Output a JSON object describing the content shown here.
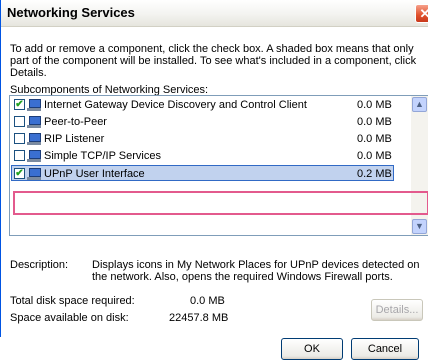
{
  "window": {
    "title": "Networking Services",
    "close_glyph": "✕"
  },
  "intro_text": "To add or remove a component, click the check box. A shaded box means that only part of the component will be installed. To see what's included in a component, click Details.",
  "subcomponents_label": "Subcomponents of Networking Services:",
  "components": [
    {
      "name": "Internet Gateway Device Discovery and Control Client",
      "size": "0.0 MB",
      "checked": true,
      "icon": "network-computer-icon"
    },
    {
      "name": "Peer-to-Peer",
      "size": "0.0 MB",
      "checked": false,
      "icon": "network-computer-icon"
    },
    {
      "name": "RIP Listener",
      "size": "0.0 MB",
      "checked": false,
      "icon": "network-computer-icon"
    },
    {
      "name": "Simple TCP/IP Services",
      "size": "0.0 MB",
      "checked": false,
      "icon": "network-computer-icon"
    },
    {
      "name": "UPnP User Interface",
      "size": "0.2 MB",
      "checked": true,
      "selected": true,
      "icon": "network-computer-icon"
    }
  ],
  "description": {
    "label": "Description:",
    "text": "Displays icons in My Network Places for UPnP devices detected on the network. Also, opens the required Windows Firewall ports."
  },
  "disk": {
    "total_label": "Total disk space required:",
    "total_value": "0.0 MB",
    "available_label": "Space available on disk:",
    "available_value": "22457.8 MB"
  },
  "buttons": {
    "details": "Details...",
    "ok": "OK",
    "cancel": "Cancel"
  },
  "colors": {
    "highlight_border": "#e35a8d",
    "selection_bg": "#c1d2ee",
    "check_mark": "#21a121"
  }
}
